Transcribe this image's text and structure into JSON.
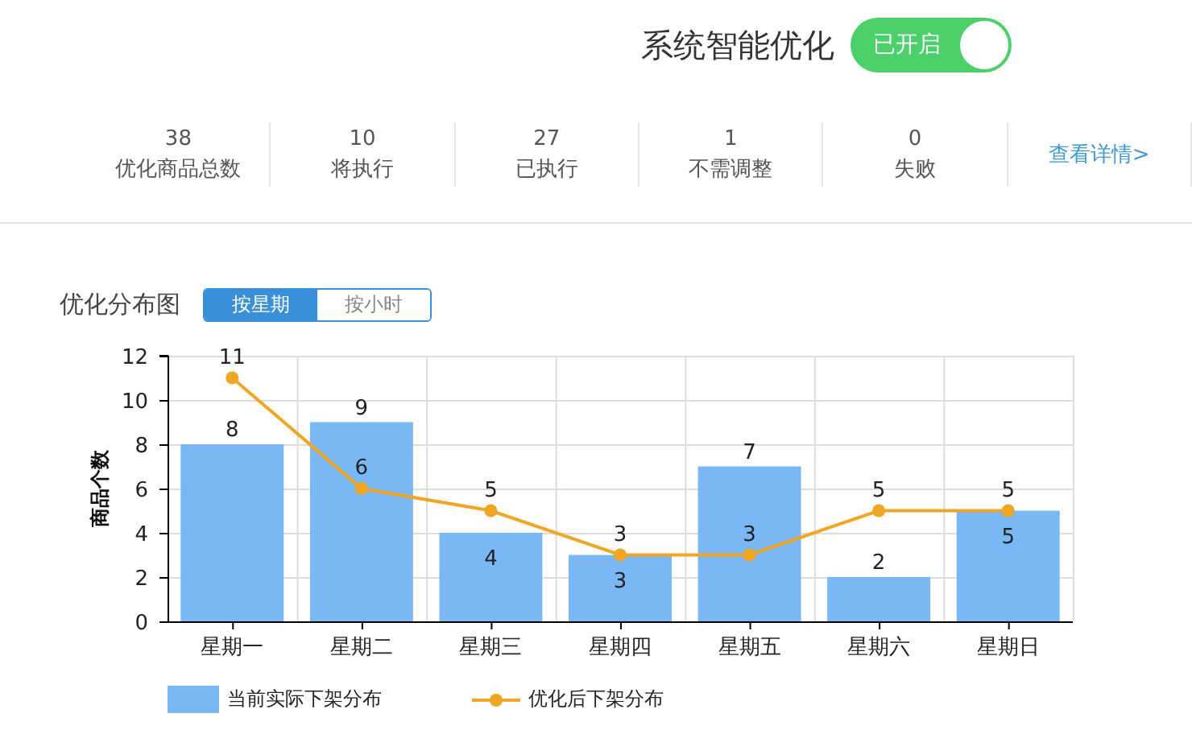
{
  "header": {
    "title": "系统智能优化",
    "toggle": {
      "label": "已开启",
      "on": true
    }
  },
  "stats": [
    {
      "value": "38",
      "label": "优化商品总数"
    },
    {
      "value": "10",
      "label": "将执行"
    },
    {
      "value": "27",
      "label": "已执行"
    },
    {
      "value": "1",
      "label": "不需调整"
    },
    {
      "value": "0",
      "label": "失败"
    }
  ],
  "details_link": "查看详情>",
  "distribution": {
    "title": "优化分布图",
    "segments": [
      {
        "label": "按星期",
        "selected": true
      },
      {
        "label": "按小时",
        "selected": false
      }
    ],
    "chart_data": {
      "type": "bar",
      "ylabel": "商品个数",
      "categories": [
        "星期一",
        "星期二",
        "星期三",
        "星期四",
        "星期五",
        "星期六",
        "星期日"
      ],
      "ylim": [
        0,
        12
      ],
      "yticks": [
        0,
        2,
        4,
        6,
        8,
        10,
        12
      ],
      "data_labels": true,
      "grid": true,
      "series": [
        {
          "name": "当前实际下架分布",
          "type": "bar",
          "color": "#7ab8f5",
          "values": [
            8,
            9,
            4,
            3,
            7,
            2,
            5
          ]
        },
        {
          "name": "优化后下架分布",
          "type": "line",
          "marker": "circle",
          "color": "#f0a623",
          "values": [
            11,
            6,
            5,
            3,
            3,
            5,
            5
          ]
        }
      ]
    }
  }
}
